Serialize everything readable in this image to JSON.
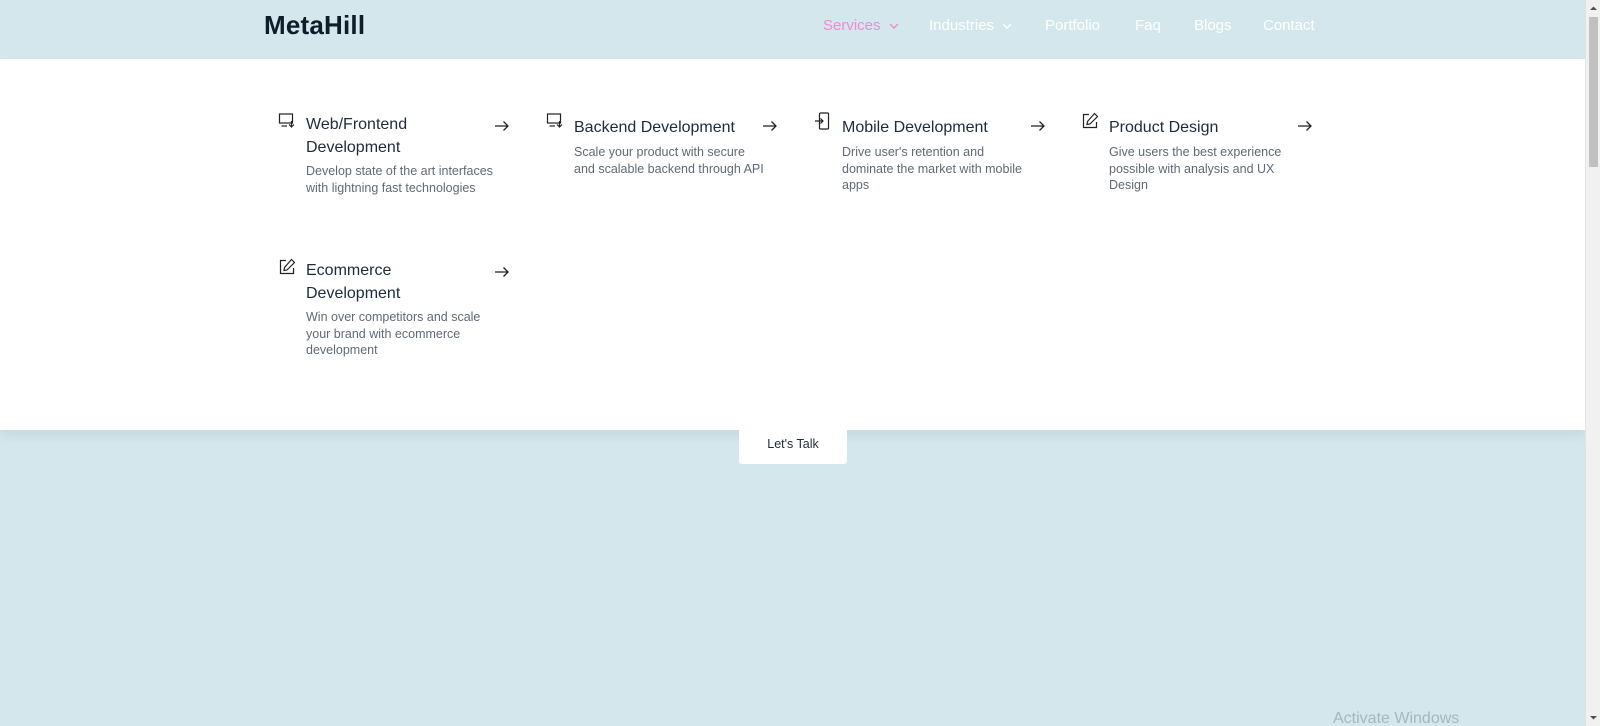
{
  "brand": {
    "logo": "MetaHill"
  },
  "nav": {
    "items": [
      {
        "label": "Services",
        "dropdown": true,
        "active": true
      },
      {
        "label": "Industries",
        "dropdown": true,
        "active": false
      },
      {
        "label": "Portfolio"
      },
      {
        "label": "Faq"
      },
      {
        "label": "Blogs"
      },
      {
        "label": "Contact"
      }
    ]
  },
  "services": [
    {
      "title": "Web/Frontend Development",
      "description": "Develop state of the art interfaces with lightning fast technologies",
      "icon": "monitor-download-icon"
    },
    {
      "title": "Backend Development",
      "description": "Scale your product with secure and scalable backend through API",
      "icon": "monitor-download-icon"
    },
    {
      "title": "Mobile Development",
      "description": "Drive user's retention and dominate the market with mobile apps",
      "icon": "phone-login-icon"
    },
    {
      "title": "Product Design",
      "description": "Give users the best experience possible with analysis and UX Design",
      "icon": "pencil-square-icon"
    },
    {
      "title": "Ecommerce Development",
      "description": "Win over competitors and scale your brand with ecommerce development",
      "icon": "pencil-square-icon"
    }
  ],
  "cta": {
    "label": "Let's Talk"
  },
  "watermark": {
    "text": "Activate Windows"
  },
  "colors": {
    "background": "#d3e7ec",
    "active_nav": "#f08ad6",
    "nav_text": "#ffffff",
    "logo": "#0f1c2a",
    "panel": "#ffffff"
  }
}
